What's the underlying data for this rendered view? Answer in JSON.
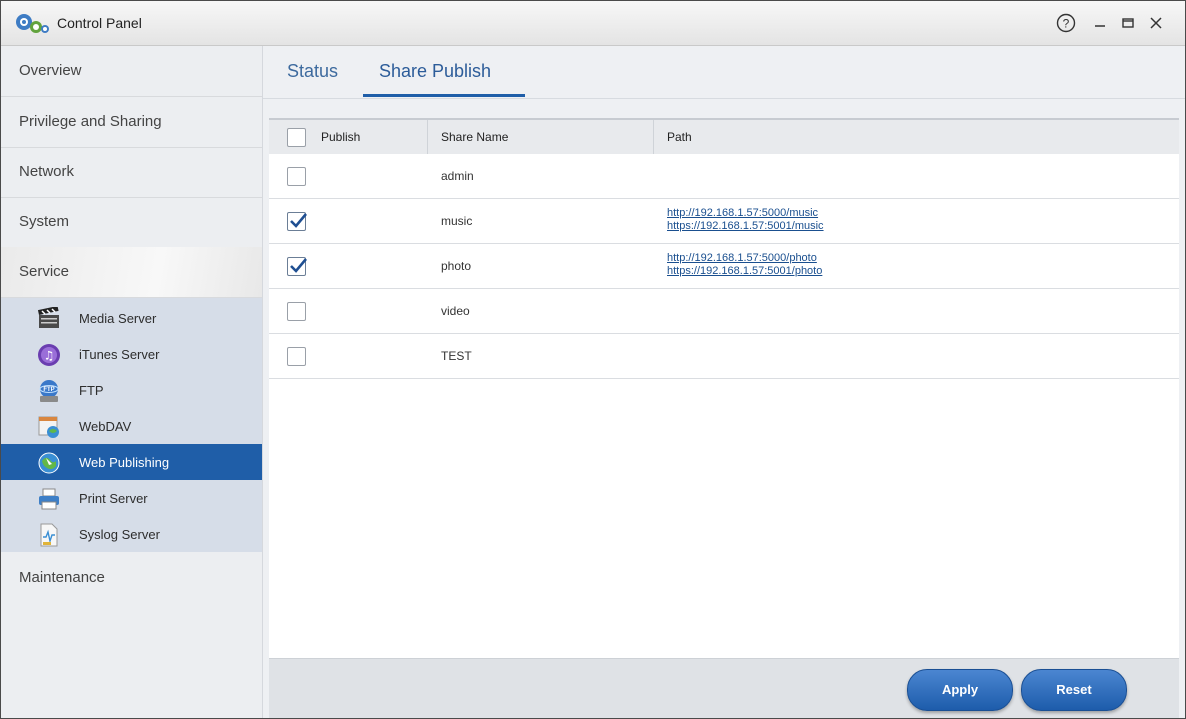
{
  "window": {
    "title": "Control Panel",
    "controls": {
      "help": "?",
      "minimize": "–",
      "maximize": "▭",
      "close": "✕"
    }
  },
  "sidebar": {
    "categories": [
      {
        "label": "Overview"
      },
      {
        "label": "Privilege and Sharing"
      },
      {
        "label": "Network"
      },
      {
        "label": "System"
      },
      {
        "label": "Service"
      },
      {
        "label": "Maintenance"
      }
    ],
    "service_items": [
      {
        "label": "Media Server",
        "icon": "media-server-icon"
      },
      {
        "label": "iTunes Server",
        "icon": "itunes-icon"
      },
      {
        "label": "FTP",
        "icon": "ftp-icon"
      },
      {
        "label": "WebDAV",
        "icon": "webdav-icon"
      },
      {
        "label": "Web Publishing",
        "icon": "web-publishing-icon",
        "active": true
      },
      {
        "label": "Print Server",
        "icon": "printer-icon"
      },
      {
        "label": "Syslog Server",
        "icon": "syslog-icon"
      }
    ]
  },
  "tabs": [
    {
      "label": "Status"
    },
    {
      "label": "Share Publish",
      "active": true
    }
  ],
  "table": {
    "columns": [
      "Publish",
      "Share Name",
      "Path"
    ],
    "rows": [
      {
        "publish": false,
        "name": "admin",
        "paths": []
      },
      {
        "publish": true,
        "name": "music",
        "paths": [
          "http://192.168.1.57:5000/music",
          "https://192.168.1.57:5001/music"
        ]
      },
      {
        "publish": true,
        "name": "photo",
        "paths": [
          "http://192.168.1.57:5000/photo",
          "https://192.168.1.57:5001/photo"
        ]
      },
      {
        "publish": false,
        "name": "video",
        "paths": []
      },
      {
        "publish": false,
        "name": "TEST",
        "paths": []
      }
    ]
  },
  "buttons": {
    "apply": "Apply",
    "reset": "Reset"
  },
  "colors": {
    "accent": "#1f5ea8",
    "link": "#1a4f8f",
    "sidebar_sub_bg": "#d6dde8"
  }
}
